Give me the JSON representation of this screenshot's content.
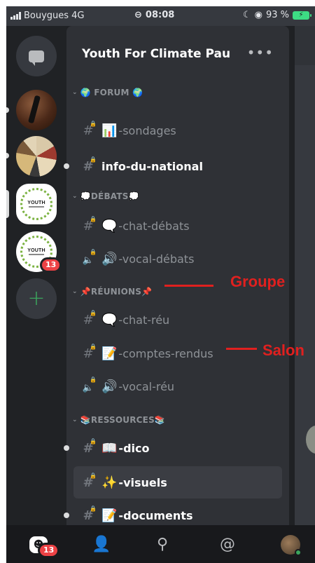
{
  "status_bar": {
    "carrier": "Bouygues",
    "network": "4G",
    "time": "08:08",
    "battery_percent": "93 %"
  },
  "server_rail": {
    "servers": [
      {
        "name": "direct-messages"
      },
      {
        "name": "server-photo-1"
      },
      {
        "name": "server-photo-2"
      },
      {
        "name": "Youth For Climate Pau",
        "logo_text": "YOUTH"
      },
      {
        "name": "youth-server-2",
        "logo_text": "YOUTH",
        "badge": "13"
      }
    ],
    "add_symbol": "+"
  },
  "server": {
    "title": "Youth For Climate Pau",
    "more_label": "•••"
  },
  "categories": [
    {
      "label": "🌍 FORUM 🌍"
    },
    {
      "label": "💭DÉBATS💭"
    },
    {
      "label": "📌RÉUNIONS📌"
    },
    {
      "label": "📚RESSOURCES📚"
    }
  ],
  "channels": [
    {
      "icon": "#",
      "emoji": "📊",
      "label": "-sondages"
    },
    {
      "icon": "#",
      "emoji": "",
      "label": "info-du-national"
    },
    {
      "icon": "#",
      "emoji": "🗨️",
      "label": "-chat-débats"
    },
    {
      "icon": "🔈",
      "emoji": "🔊",
      "label": "-vocal-débats"
    },
    {
      "icon": "#",
      "emoji": "🗨️",
      "label": "-chat-réu"
    },
    {
      "icon": "#",
      "emoji": "📝",
      "label": "-comptes-rendus"
    },
    {
      "icon": "🔈",
      "emoji": "🔊",
      "label": "-vocal-réu"
    },
    {
      "icon": "#",
      "emoji": "📖",
      "label": "-dico"
    },
    {
      "icon": "#",
      "emoji": "✨",
      "label": "-visuels"
    },
    {
      "icon": "#",
      "emoji": "📝",
      "label": "-documents"
    }
  ],
  "annotations": {
    "group_label": "Groupe",
    "channel_label": "Salon",
    "color": "#e0201f"
  },
  "bottom_nav": {
    "home_badge": "13",
    "icons": [
      "home-icon",
      "friends-icon",
      "search-icon",
      "mentions-icon",
      "avatar"
    ]
  },
  "colors": {
    "rail": "#202225",
    "panel": "#2f3136",
    "accent_green": "#3ba55d",
    "badge_red": "#ed4245"
  }
}
